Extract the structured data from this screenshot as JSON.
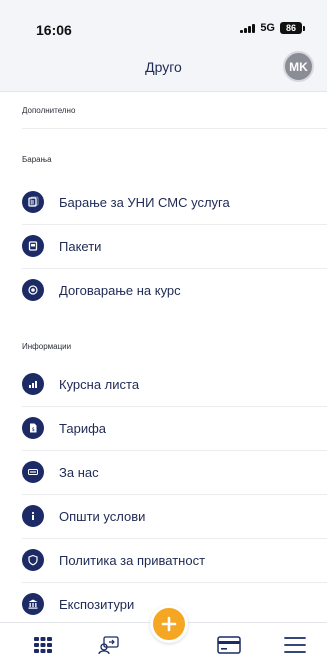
{
  "status_bar": {
    "time": "16:06",
    "network": "5G",
    "battery": "86"
  },
  "header": {
    "title": "Друго",
    "avatar_initials": "MK"
  },
  "sections": [
    {
      "label": "Дополнително",
      "items": []
    },
    {
      "label": "Барања",
      "items": [
        {
          "label": "Барање за УНИ СМС услуга",
          "icon": "sms-service-icon"
        },
        {
          "label": "Пакети",
          "icon": "package-icon"
        },
        {
          "label": "Договарање на курс",
          "icon": "exchange-rate-deal-icon"
        }
      ]
    },
    {
      "label": "Информации",
      "items": [
        {
          "label": "Курсна листа",
          "icon": "exchange-rate-chart-icon"
        },
        {
          "label": "Тарифа",
          "icon": "tariff-document-icon"
        },
        {
          "label": "За нас",
          "icon": "about-us-icon"
        },
        {
          "label": "Општи услови",
          "icon": "info-icon"
        },
        {
          "label": "Политика за приватност",
          "icon": "shield-icon"
        },
        {
          "label": "Експозитури",
          "icon": "bank-branch-icon"
        }
      ]
    }
  ],
  "bottom_nav": [
    {
      "icon": "grid-menu-icon"
    },
    {
      "icon": "transfer-icon"
    },
    {
      "icon": "plus-icon"
    },
    {
      "icon": "card-icon"
    },
    {
      "icon": "hamburger-icon"
    }
  ],
  "colors": {
    "accent": "#1c2b66",
    "fab": "#f5a623",
    "header_bg": "#f4f5f8"
  }
}
